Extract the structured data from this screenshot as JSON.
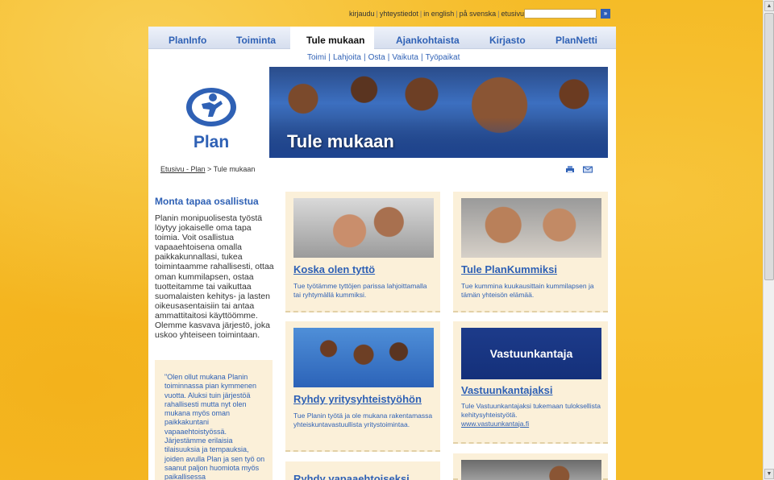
{
  "utility_links": [
    "kirjaudu",
    "yhteystiedot",
    "in english",
    "på svenska",
    "etusivu"
  ],
  "search": {
    "go_symbol": "»"
  },
  "nav": {
    "items": [
      "PlanInfo",
      "Toiminta",
      "Tule mukaan",
      "Ajankohtaista",
      "Kirjasto",
      "PlanNetti"
    ],
    "active_index": 2
  },
  "subnav": [
    "Toimi",
    "Lahjoita",
    "Osta",
    "Vaikuta",
    "Työpaikat"
  ],
  "banner": {
    "logo_text": "Plan",
    "title": "Tule mukaan"
  },
  "breadcrumb": {
    "home": "Etusivu - Plan",
    "separator": " > ",
    "current": "Tule mukaan"
  },
  "left": {
    "title": "Monta tapaa osallistua",
    "text": "Planin monipuolisesta työstä löytyy jokaiselle oma tapa toimia. Voit osallistua vapaaehtoisena omalla paikkakunnallasi, tukea toimintaamme rahallisesti, ottaa oman kummilapsen, ostaa tuotteitamme tai vaikuttaa suomalaisten kehitys- ja lasten oikeusasentaisiin tai antaa ammattitaitosi käyttöömme. Olemme kasvava järjestö, joka uskoo yhteiseen toimintaan.",
    "quote": "\"Olen ollut mukana Planin toiminnassa pian kymmenen vuotta. Aluksi tuin järjestöä rahallisesti mutta nyt olen mukana myös oman paikkakuntani vapaaehtoistyössä. Järjestämme erilaisia tilaisuuksia ja tempauksia, joiden avulla Plan ja sen työ on saanut paljon huomiota myös paikallisessa"
  },
  "cards": [
    {
      "title": "Koska olen tyttö",
      "desc": "Tue työtämme tyttöjen parissa lahjoittamalla tai ryhtymällä kummiksi."
    },
    {
      "title": "Tule PlanKummiksi",
      "desc": "Tue kummina kuukausittain kummilapsen ja tämän yhteisön elämää."
    },
    {
      "title": "Ryhdy yritysyhteistyöhön",
      "desc": "Tue Planin työtä ja ole mukana rakentamassa yhteiskuntavastuullista yritystoimintaa."
    },
    {
      "title": "Vastuunkantajaksi",
      "desc": "Tule Vastuunkantajaksi tukemaan tuloksellista kehitysyhteistyötä.",
      "link": "www.vastuunkantaja.fi",
      "image_text": "Vastuunkantaja"
    },
    {
      "title": "Ryhdy vapaaehtoiseksi",
      "desc": ""
    }
  ],
  "colors": {
    "accent_blue": "#2f61b5",
    "background_yellow": "#f5bb26",
    "card_bg": "#fbf0d9"
  }
}
